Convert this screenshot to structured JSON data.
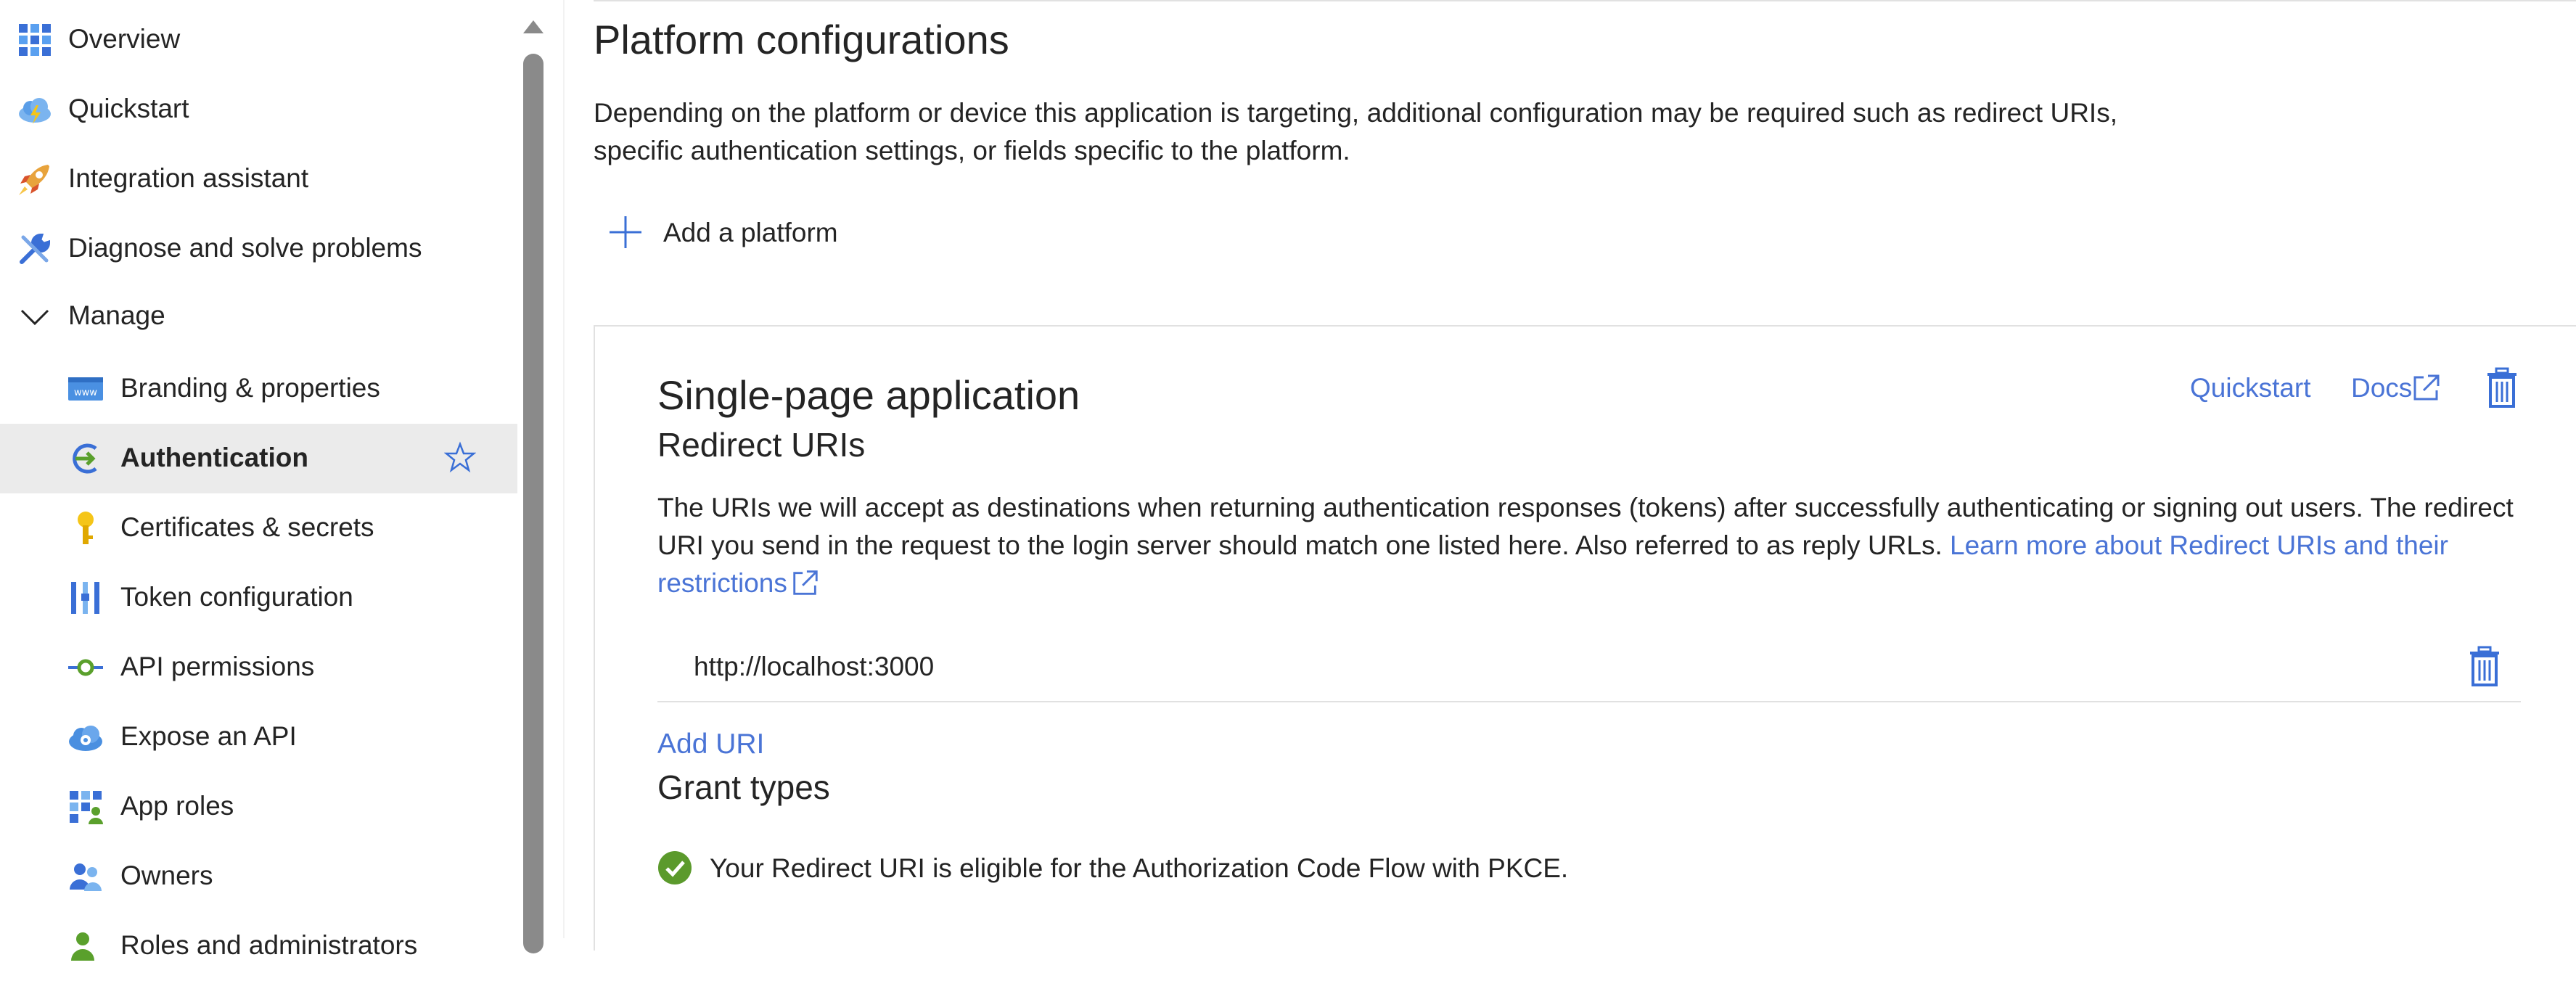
{
  "sidebar": {
    "top_items": [
      {
        "label": "Overview",
        "icon": "grid-icon"
      },
      {
        "label": "Quickstart",
        "icon": "cloud-lightning-icon"
      },
      {
        "label": "Integration assistant",
        "icon": "rocket-icon"
      },
      {
        "label": "Diagnose and solve problems",
        "icon": "wrench-icon"
      }
    ],
    "manage": {
      "label": "Manage",
      "icon": "chevron-down-icon"
    },
    "sub_items": [
      {
        "label": "Branding & properties",
        "icon": "www-icon"
      },
      {
        "label": "Authentication",
        "icon": "authentication-icon",
        "selected": true
      },
      {
        "label": "Certificates & secrets",
        "icon": "key-icon"
      },
      {
        "label": "Token configuration",
        "icon": "token-bars-icon"
      },
      {
        "label": "API permissions",
        "icon": "api-permissions-icon"
      },
      {
        "label": "Expose an API",
        "icon": "cloud-api-icon"
      },
      {
        "label": "App roles",
        "icon": "app-roles-icon"
      },
      {
        "label": "Owners",
        "icon": "people-icon"
      },
      {
        "label": "Roles and administrators",
        "icon": "roles-icon"
      }
    ]
  },
  "main": {
    "title": "Platform configurations",
    "description": "Depending on the platform or device this application is targeting, additional configuration may be required such as redirect URIs, specific authentication settings, or fields specific to the platform.",
    "add_platform_label": "Add a platform",
    "spa": {
      "title": "Single-page application",
      "quickstart_label": "Quickstart",
      "docs_label": "Docs",
      "redirect_heading": "Redirect URIs",
      "redirect_desc": "The URIs we will accept as destinations when returning authentication responses (tokens) after successfully authenticating or signing out users. The redirect URI you send in the request to the login server should match one listed here. Also referred to as reply URLs.",
      "learn_more_label": "Learn more about Redirect URIs and their restrictions",
      "uris": [
        "http://localhost:3000"
      ],
      "add_uri_label": "Add URI",
      "grant_heading": "Grant types",
      "grant_message": "Your Redirect URI is eligible for the Authorization Code Flow with PKCE."
    }
  },
  "colors": {
    "link": "#4a74d6",
    "selected_bg": "#ebebeb",
    "success": "#5b9a2c",
    "text": "#242424"
  }
}
